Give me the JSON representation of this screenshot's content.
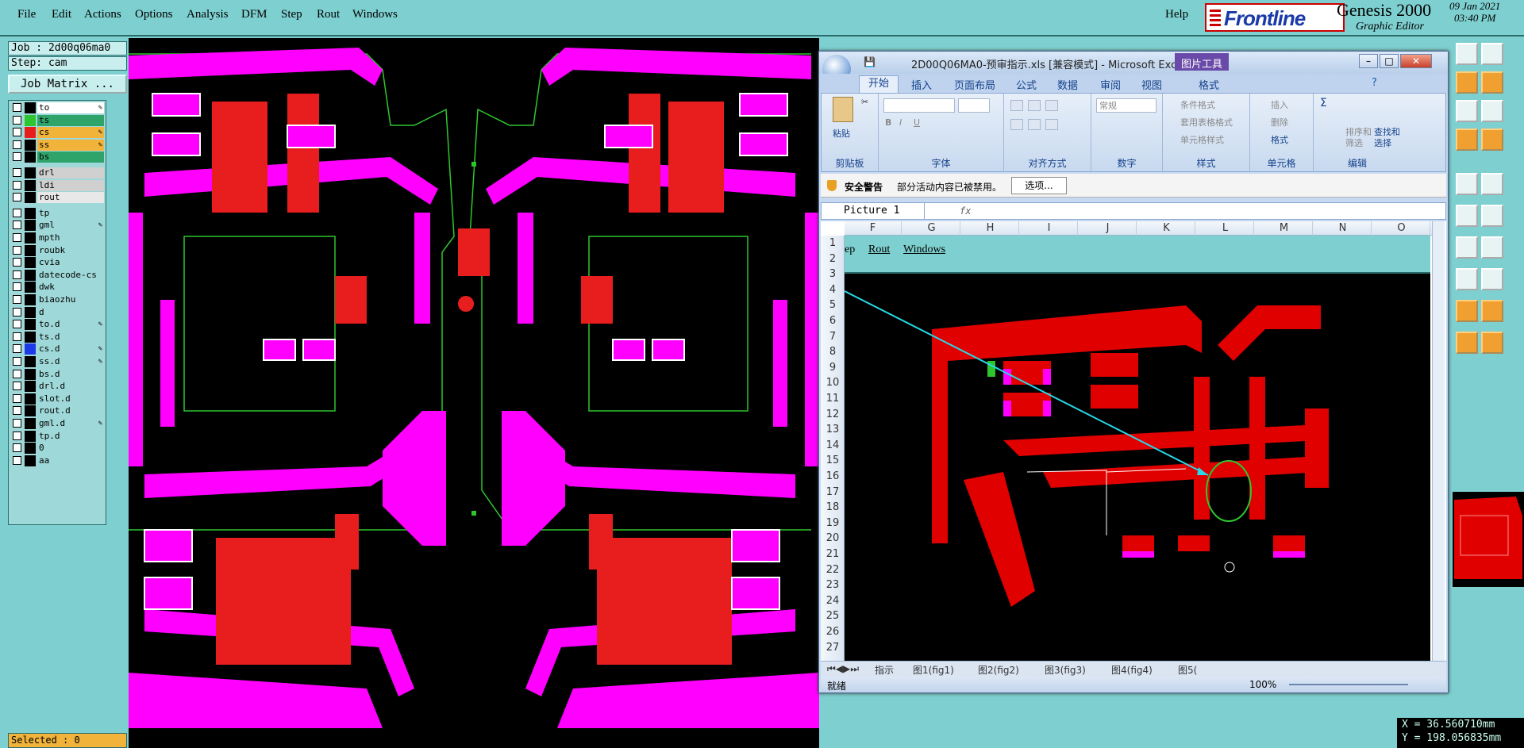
{
  "menubar": {
    "items": [
      {
        "label": "File"
      },
      {
        "label": "Edit"
      },
      {
        "label": "Actions"
      },
      {
        "label": "Options"
      },
      {
        "label": "Analysis"
      },
      {
        "label": "DFM"
      },
      {
        "label": "Step"
      },
      {
        "label": "Rout"
      },
      {
        "label": "Windows"
      }
    ],
    "help": "Help"
  },
  "brand": {
    "logo": "Frontline",
    "title": "Genesis 2000",
    "subtitle": "Graphic Editor",
    "date": "09 Jan 2021",
    "time": "03:40 PM"
  },
  "job": {
    "job_line": "Job : 2d00q06ma0",
    "step_line": "Step: cam",
    "matrix_button": "Job Matrix ..."
  },
  "layers": [
    {
      "name": "to",
      "color": "#ffffff",
      "swatch": "#000000",
      "edit": true
    },
    {
      "name": "ts",
      "color": "#2fa46a",
      "swatch": "#2ec62e",
      "edit": false
    },
    {
      "name": "cs",
      "color": "#f1b33a",
      "swatch": "#e81e1e",
      "edit": true
    },
    {
      "name": "ss",
      "color": "#f1b33a",
      "swatch": "#000000",
      "edit": true
    },
    {
      "name": "bs",
      "color": "#2fa46a",
      "swatch": "#000000",
      "edit": false
    },
    {
      "name": "drl",
      "color": "#d0d0d0",
      "swatch": "#000000",
      "edit": false
    },
    {
      "name": "ldi",
      "color": "#d0d0d0",
      "swatch": "#000000",
      "edit": false
    },
    {
      "name": "rout",
      "color": "#e8e8e8",
      "swatch": "#000000",
      "edit": false
    },
    {
      "name": "tp",
      "color": "#9fd8d8",
      "swatch": "#000000",
      "edit": false
    },
    {
      "name": "gml",
      "color": "#9fd8d8",
      "swatch": "#000000",
      "edit": true
    },
    {
      "name": "mpth",
      "color": "#9fd8d8",
      "swatch": "#000000",
      "edit": false
    },
    {
      "name": "roubk",
      "color": "#9fd8d8",
      "swatch": "#000000",
      "edit": false
    },
    {
      "name": "cvia",
      "color": "#9fd8d8",
      "swatch": "#000000",
      "edit": false
    },
    {
      "name": "datecode-cs",
      "color": "#9fd8d8",
      "swatch": "#000000",
      "edit": false
    },
    {
      "name": "dwk",
      "color": "#9fd8d8",
      "swatch": "#000000",
      "edit": false
    },
    {
      "name": "biaozhu",
      "color": "#9fd8d8",
      "swatch": "#000000",
      "edit": false
    },
    {
      "name": "d",
      "color": "#9fd8d8",
      "swatch": "#000000",
      "edit": false
    },
    {
      "name": "to.d",
      "color": "#9fd8d8",
      "swatch": "#000000",
      "edit": true
    },
    {
      "name": "ts.d",
      "color": "#9fd8d8",
      "swatch": "#000000",
      "edit": false
    },
    {
      "name": "cs.d",
      "color": "#9fd8d8",
      "swatch": "#1e3ae8",
      "edit": true
    },
    {
      "name": "ss.d",
      "color": "#9fd8d8",
      "swatch": "#000000",
      "edit": true
    },
    {
      "name": "bs.d",
      "color": "#9fd8d8",
      "swatch": "#000000",
      "edit": false
    },
    {
      "name": "drl.d",
      "color": "#9fd8d8",
      "swatch": "#000000",
      "edit": false
    },
    {
      "name": "slot.d",
      "color": "#9fd8d8",
      "swatch": "#000000",
      "edit": false
    },
    {
      "name": "rout.d",
      "color": "#9fd8d8",
      "swatch": "#000000",
      "edit": false
    },
    {
      "name": "gml.d",
      "color": "#9fd8d8",
      "swatch": "#000000",
      "edit": true
    },
    {
      "name": "tp.d",
      "color": "#9fd8d8",
      "swatch": "#000000",
      "edit": false
    },
    {
      "name": "0",
      "color": "#9fd8d8",
      "swatch": "#000000",
      "edit": false
    },
    {
      "name": "aa",
      "color": "#9fd8d8",
      "swatch": "#000000",
      "edit": false
    }
  ],
  "status": {
    "selected": "Selected : 0"
  },
  "coords": {
    "x": "X =  36.560710mm",
    "y": "Y = 198.056835mm"
  },
  "colors": {
    "trace_magenta": "#ff00ff",
    "pad_red": "#e81e1e",
    "outline_green": "#2ec62e",
    "excel_trace_red": "#e00000",
    "arrow_cyan": "#28d8e8"
  },
  "excel": {
    "title": "2D00Q06MA0-预审指示.xls  [兼容模式] - Microsoft Exc...",
    "picture_tools": "图片工具",
    "tabs": [
      "开始",
      "插入",
      "页面布局",
      "公式",
      "数据",
      "审阅",
      "视图",
      "格式"
    ],
    "ribbon": {
      "paste": "粘贴",
      "clipboard": "剪贴板",
      "font": "字体",
      "alignment": "对齐方式",
      "number_format": "常规",
      "number": "数字",
      "cond_format": "条件格式",
      "table_format": "套用表格格式",
      "cell_style": "单元格样式",
      "styles": "样式",
      "insert": "插入",
      "delete": "删除",
      "format": "格式",
      "cells": "单元格",
      "sort": "排序和",
      "filter": "筛选",
      "find": "查找和",
      "select": "选择",
      "editing": "编辑",
      "sum": "Σ"
    },
    "security": {
      "title": "安全警告",
      "message": "部分活动内容已被禁用。",
      "options": "选项..."
    },
    "namebox": "Picture 1",
    "fx": "fx",
    "columns": [
      "F",
      "G",
      "H",
      "I",
      "J",
      "K",
      "L",
      "M",
      "N",
      "O"
    ],
    "rows": [
      "1",
      "2",
      "3",
      "4",
      "5",
      "6",
      "7",
      "8",
      "9",
      "10",
      "11",
      "12",
      "13",
      "14",
      "15",
      "16",
      "17",
      "18",
      "19",
      "20",
      "21",
      "22",
      "23",
      "24",
      "25",
      "26",
      "27"
    ],
    "pic_menu": [
      "ep",
      "Rout",
      "Windows"
    ],
    "sheet_tabs": [
      "指示",
      "图1(fig1)",
      "图2(fig2)",
      "图3(fig3)",
      "图4(fig4)",
      "图5("
    ],
    "status": "就绪",
    "zoom": "100%"
  }
}
